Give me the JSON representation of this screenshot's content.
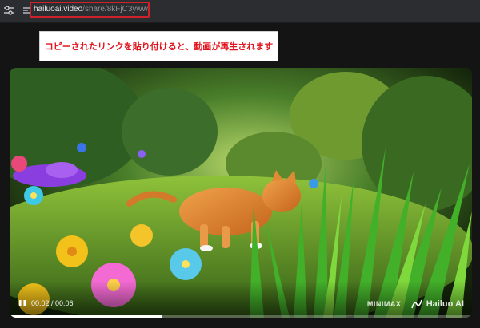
{
  "browser": {
    "url_host": "hailuoai.video",
    "url_path": "/share/8kFjC3ywwMm",
    "icons": {
      "site_settings": "tune-icon",
      "page_info": "info-icon"
    }
  },
  "annotation": {
    "text": "コピーされたリンクを貼り付けると、動画が再生されます",
    "color": "#e0161f"
  },
  "video": {
    "state": "playing",
    "time_display": "00:02 / 00:06",
    "current_seconds": 2,
    "duration_seconds": 6,
    "progress_fraction": 0.33,
    "watermark": {
      "brand_left": "MINIMAX",
      "separator": "|",
      "brand_right": "Hailuo AI"
    }
  },
  "colors": {
    "highlight_border": "#d0202a",
    "browser_bar": "#2b2d31",
    "page_background": "#141414"
  }
}
